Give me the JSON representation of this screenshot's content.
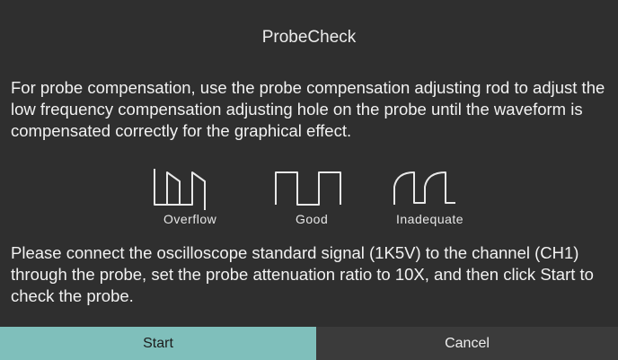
{
  "dialog": {
    "title": "ProbeCheck",
    "instruction_top": "For probe compensation, use the probe compensation adjusting rod to adjust the low frequency compensation adjusting hole on the probe until the waveform is compensated correctly for the graphical effect.",
    "waveforms": [
      {
        "label": "Overflow",
        "icon": "overcompensated-square-wave"
      },
      {
        "label": "Good",
        "icon": "square-wave"
      },
      {
        "label": "Inadequate",
        "icon": "undercompensated-square-wave"
      }
    ],
    "instruction_bottom": "Please connect the oscilloscope standard signal (1K5V) to the channel (CH1) through the probe, set the probe attenuation ratio to 10X, and then click Start to check the probe.",
    "start_label": "Start",
    "cancel_label": "Cancel"
  },
  "colors": {
    "dialog_bg": "#2f2f2f",
    "start_bg": "#7fbfbb",
    "cancel_bg": "#3b3b3b",
    "text": "#f2f2f2"
  }
}
